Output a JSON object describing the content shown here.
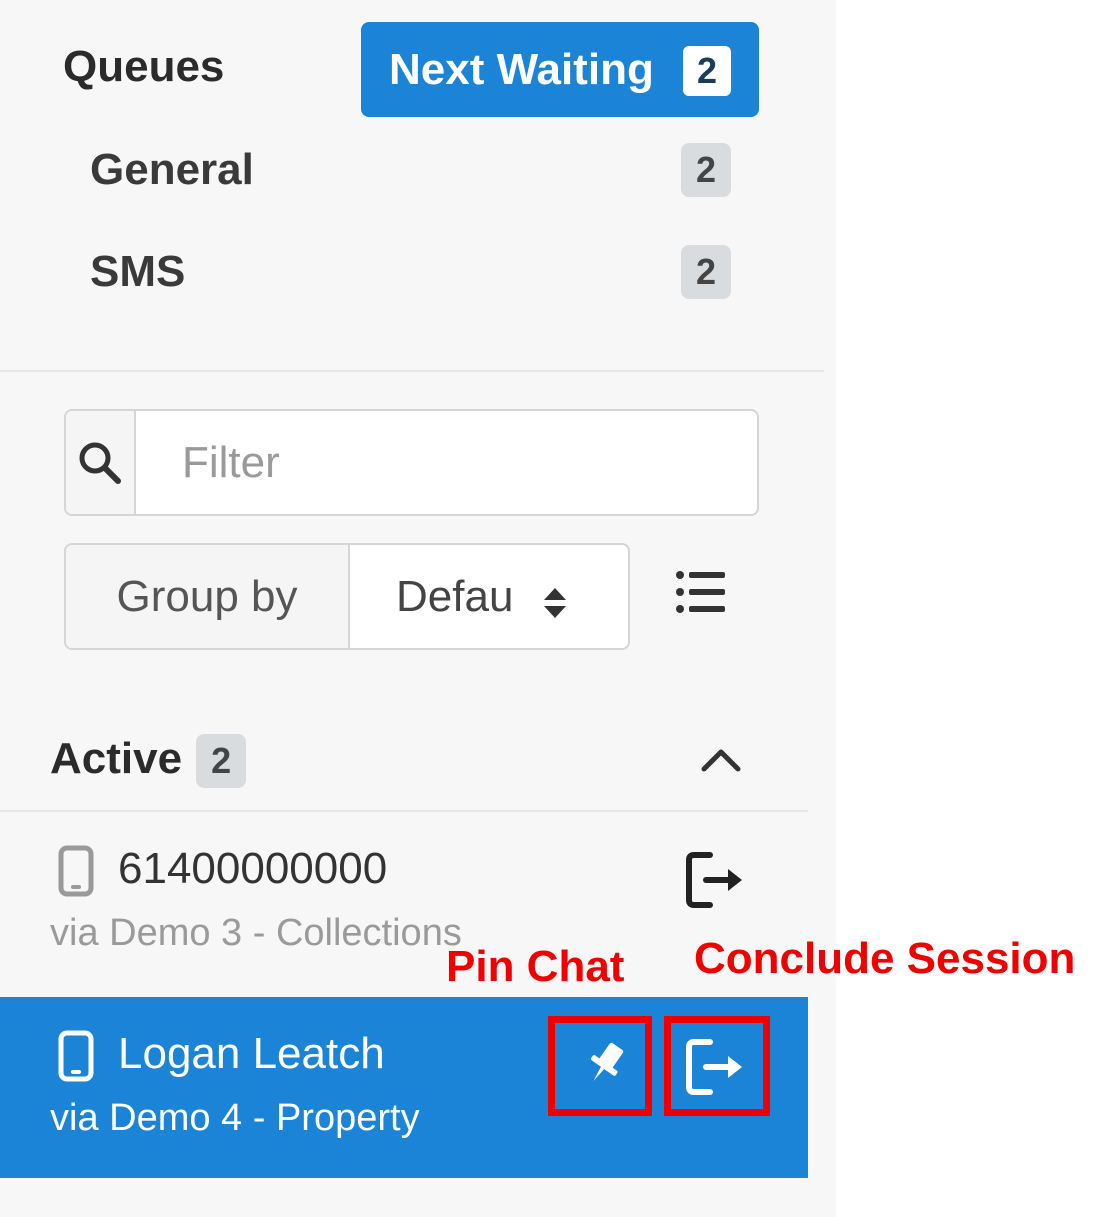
{
  "queues": {
    "title": "Queues",
    "next_waiting": {
      "label": "Next Waiting",
      "count": "2"
    },
    "items": [
      {
        "name": "General",
        "count": "2"
      },
      {
        "name": "SMS",
        "count": "2"
      }
    ]
  },
  "filter": {
    "placeholder": "Filter"
  },
  "group_by": {
    "label": "Group by",
    "selected": "Defau"
  },
  "active": {
    "title": "Active",
    "count": "2",
    "sessions": [
      {
        "title": "61400000000",
        "subtitle": "via Demo 3 - Collections"
      },
      {
        "title": "Logan Leatch",
        "subtitle": "via Demo 4 - Property"
      }
    ]
  },
  "annotations": {
    "pin_chat": "Pin Chat",
    "conclude_session": "Conclude Session"
  },
  "colors": {
    "accent": "#1b84d6",
    "annotation_red": "#ee0000",
    "panel_bg": "#f7f7f7"
  }
}
